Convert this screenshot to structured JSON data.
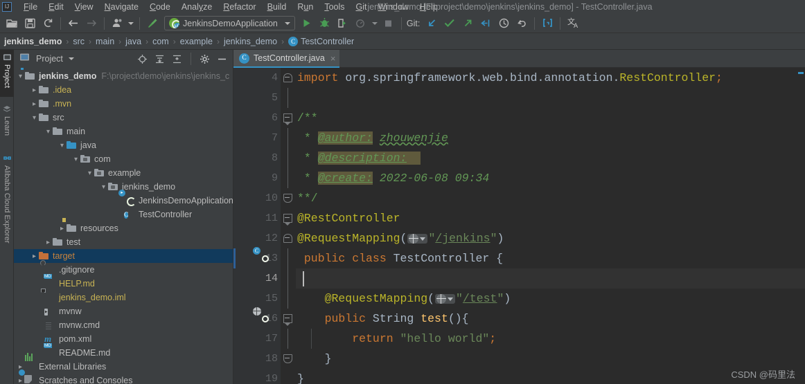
{
  "window": {
    "title": "jenkins_demo [F:\\project\\demo\\jenkins\\jenkins_demo] - TestController.java",
    "logo": "IJ"
  },
  "menubar": {
    "items": [
      {
        "label": "File",
        "mnemonic": "F"
      },
      {
        "label": "Edit",
        "mnemonic": "E"
      },
      {
        "label": "View",
        "mnemonic": "V"
      },
      {
        "label": "Navigate",
        "mnemonic": "N"
      },
      {
        "label": "Code",
        "mnemonic": "C"
      },
      {
        "label": "Analyze",
        "mnemonic": "y"
      },
      {
        "label": "Refactor",
        "mnemonic": "R"
      },
      {
        "label": "Build",
        "mnemonic": "B"
      },
      {
        "label": "Run",
        "mnemonic": "u"
      },
      {
        "label": "Tools",
        "mnemonic": "T"
      },
      {
        "label": "Git",
        "mnemonic": "G"
      },
      {
        "label": "Window",
        "mnemonic": "W"
      },
      {
        "label": "Help",
        "mnemonic": "H"
      }
    ]
  },
  "toolbar": {
    "open_project": "open-project-icon",
    "save_all": "save-all-icon",
    "sync": "refresh-sync-icon",
    "back": "navigate-back-icon",
    "forward": "navigate-forward-icon",
    "profile": "profile-icon",
    "build_hammer": "build-hammer-icon",
    "run_config_name": "JenkinsDemoApplication",
    "run": "run-icon",
    "debug": "debug-icon",
    "run_with_coverage": "run-with-coverage-icon",
    "profiler": "profiler-icon",
    "stop": "stop-icon",
    "git_label": "Git:",
    "git_update": "git-update-icon",
    "git_commit": "git-commit-icon",
    "git_push": "git-push-icon",
    "git_rollback_arrow": "git-revert-icon",
    "history": "history-icon",
    "undo": "undo-icon",
    "search_everywhere": "search-everywhere-icon",
    "translate": "translate-icon"
  },
  "breadcrumb": {
    "items": [
      "jenkins_demo",
      "src",
      "main",
      "java",
      "com",
      "example",
      "jenkins_demo",
      "TestController"
    ],
    "last_icon": "C",
    "separator": "›"
  },
  "project_panel": {
    "title": "Project",
    "dropdown_caret": "chevron-down-icon",
    "buttons": [
      {
        "name": "select-opened-file-icon"
      },
      {
        "name": "expand-all-icon"
      },
      {
        "name": "collapse-all-icon"
      },
      {
        "name": "settings-gear-icon"
      },
      {
        "name": "hide-panel-icon"
      }
    ],
    "tree": [
      {
        "depth": 0,
        "twist": "v",
        "icon": "module-folder",
        "label": "jenkins_demo",
        "bold": true,
        "path": "F:\\project\\demo\\jenkins\\jenkins_c",
        "selected": false
      },
      {
        "depth": 1,
        "twist": ">",
        "icon": "folder",
        "label": ".idea",
        "color": "yellow"
      },
      {
        "depth": 1,
        "twist": ">",
        "icon": "folder",
        "label": ".mvn",
        "color": "yellow"
      },
      {
        "depth": 1,
        "twist": "v",
        "icon": "folder",
        "label": "src"
      },
      {
        "depth": 2,
        "twist": "v",
        "icon": "folder",
        "label": "main"
      },
      {
        "depth": 3,
        "twist": "v",
        "icon": "folder-blue",
        "label": "java"
      },
      {
        "depth": 4,
        "twist": "v",
        "icon": "package",
        "label": "com"
      },
      {
        "depth": 5,
        "twist": "v",
        "icon": "package",
        "label": "example"
      },
      {
        "depth": 6,
        "twist": "v",
        "icon": "package",
        "label": "jenkins_demo"
      },
      {
        "depth": 7,
        "twist": "",
        "icon": "spring-class",
        "label": "JenkinsDemoApplication"
      },
      {
        "depth": 7,
        "twist": "",
        "icon": "class",
        "label": "TestController"
      },
      {
        "depth": 3,
        "twist": ">",
        "icon": "folder-resources",
        "label": "resources"
      },
      {
        "depth": 2,
        "twist": ">",
        "icon": "folder",
        "label": "test"
      },
      {
        "depth": 1,
        "twist": ">",
        "icon": "folder-orange",
        "label": "target",
        "color": "orange",
        "selected": true
      },
      {
        "depth": 2,
        "twist": "",
        "icon": "file-gitignore",
        "label": ".gitignore"
      },
      {
        "depth": 2,
        "twist": "",
        "icon": "file-md",
        "label": "HELP.md",
        "color": "yellow"
      },
      {
        "depth": 2,
        "twist": "",
        "icon": "file-iml",
        "label": "jenkins_demo.iml",
        "color": "yellow"
      },
      {
        "depth": 2,
        "twist": "",
        "icon": "file-script",
        "label": "mvnw"
      },
      {
        "depth": 2,
        "twist": "",
        "icon": "file-cmd",
        "label": "mvnw.cmd"
      },
      {
        "depth": 2,
        "twist": "",
        "icon": "file-maven",
        "label": "pom.xml"
      },
      {
        "depth": 2,
        "twist": "",
        "icon": "file-md",
        "label": "README.md"
      },
      {
        "depth": 0,
        "twist": ">",
        "icon": "external-libraries",
        "label": "External Libraries"
      },
      {
        "depth": 0,
        "twist": ">",
        "icon": "scratches",
        "label": "Scratches and Consoles"
      }
    ]
  },
  "tool_strip": {
    "tabs": [
      {
        "label": "Project",
        "icon": "project-icon",
        "active": true
      },
      {
        "label": "Learn",
        "icon": "learn-icon",
        "active": false
      },
      {
        "label": "Alibaba Cloud Explorer",
        "icon": "cloud-icon",
        "active": false
      }
    ]
  },
  "editor": {
    "tab": {
      "name": "TestController.java",
      "icon": "C",
      "close": "×"
    },
    "first_line_number": 4,
    "current_line": 14,
    "lines": [
      {
        "n": 4,
        "fold": "cap-top",
        "indent": 0,
        "tokens": [
          {
            "t": "import ",
            "c": "kw"
          },
          {
            "t": "org.springframework.web.bind.annotation.",
            "c": "cls"
          },
          {
            "t": "RestController",
            "c": "anno"
          },
          {
            "t": ";",
            "c": "kw"
          }
        ]
      },
      {
        "n": 5,
        "fold": "line",
        "indent": 0,
        "tokens": []
      },
      {
        "n": 6,
        "fold": "arrow",
        "indent": 0,
        "tokens": [
          {
            "t": "/**",
            "c": "cmt"
          }
        ]
      },
      {
        "n": 7,
        "fold": "line",
        "indent": 0,
        "tokens": [
          {
            "t": " * ",
            "c": "cmt"
          },
          {
            "t": "@author:",
            "c": "cmt-tag"
          },
          {
            "t": " ",
            "c": "cmt"
          },
          {
            "t": "zhouwenjie",
            "c": "cmt-val-squig"
          }
        ]
      },
      {
        "n": 8,
        "fold": "line",
        "indent": 0,
        "tokens": [
          {
            "t": " * ",
            "c": "cmt"
          },
          {
            "t": "@description:",
            "c": "cmt-tag"
          },
          {
            "t": " ",
            "c": "cmt"
          }
        ]
      },
      {
        "n": 9,
        "fold": "line",
        "indent": 0,
        "tokens": [
          {
            "t": " * ",
            "c": "cmt"
          },
          {
            "t": "@create:",
            "c": "cmt-tag"
          },
          {
            "t": " ",
            "c": "cmt"
          },
          {
            "t": "2022-06-08 09:34",
            "c": "cmt-val"
          }
        ]
      },
      {
        "n": 10,
        "fold": "cap-bot",
        "indent": 0,
        "tokens": [
          {
            "t": "**/",
            "c": "cmt"
          }
        ]
      },
      {
        "n": 11,
        "fold": "arrow",
        "indent": 0,
        "tokens": [
          {
            "t": "@RestController",
            "c": "anno"
          }
        ]
      },
      {
        "n": 12,
        "fold": "cap-top",
        "indent": 0,
        "tokens": [
          {
            "t": "@RequestMapping",
            "c": "anno"
          },
          {
            "t": "(",
            "c": "punct"
          },
          {
            "t": "web-inlay",
            "c": "inlay"
          },
          {
            "t": "\"",
            "c": "str"
          },
          {
            "t": "/jenkins",
            "c": "urlstr"
          },
          {
            "t": "\"",
            "c": "str"
          },
          {
            "t": ")",
            "c": "punct"
          }
        ]
      },
      {
        "n": 13,
        "fold": "none",
        "gutter_icon": "spring-bean-icon",
        "indent": 1,
        "tokens": [
          {
            "t": "public class ",
            "c": "kw"
          },
          {
            "t": "TestController ",
            "c": "cls"
          },
          {
            "t": "{",
            "c": "punct"
          }
        ]
      },
      {
        "n": 14,
        "fold": "none",
        "current": true,
        "indent": 1,
        "tokens": []
      },
      {
        "n": 15,
        "fold": "none",
        "indent": 2,
        "tokens": [
          {
            "t": "    @RequestMapping",
            "c": "anno"
          },
          {
            "t": "(",
            "c": "punct"
          },
          {
            "t": "web-inlay",
            "c": "inlay"
          },
          {
            "t": "\"",
            "c": "str"
          },
          {
            "t": "/test",
            "c": "urlstr"
          },
          {
            "t": "\"",
            "c": "str"
          },
          {
            "t": ")",
            "c": "punct"
          }
        ]
      },
      {
        "n": 16,
        "fold": "arrow",
        "gutter_icon": "web-endpoint-icon",
        "indent": 2,
        "tokens": [
          {
            "t": "    public ",
            "c": "kw"
          },
          {
            "t": "String ",
            "c": "cls"
          },
          {
            "t": "test",
            "c": "mth"
          },
          {
            "t": "(){",
            "c": "punct"
          }
        ]
      },
      {
        "n": 17,
        "fold": "line",
        "indent": 3,
        "tokens": [
          {
            "t": "        return ",
            "c": "kw"
          },
          {
            "t": "\"hello world\"",
            "c": "str"
          },
          {
            "t": ";",
            "c": "kw"
          }
        ]
      },
      {
        "n": 18,
        "fold": "cap-bot",
        "indent": 2,
        "tokens": [
          {
            "t": "    }",
            "c": "punct"
          }
        ]
      },
      {
        "n": 19,
        "fold": "none",
        "indent": 0,
        "tokens": [
          {
            "t": "}",
            "c": "punct"
          }
        ]
      }
    ]
  },
  "watermark": "CSDN @码里法",
  "colors": {
    "bg_chrome": "#3c3f41",
    "bg_editor": "#2b2b2b",
    "gutter": "#313335",
    "accent_blue": "#3592c4",
    "accent_green": "#6aab3e",
    "keyword_orange": "#cc7832",
    "string_green": "#6a8759",
    "annotation_yellow": "#bbb529",
    "comment_green": "#629755",
    "method_gold": "#ffc66d",
    "selection_blue": "#0d293e",
    "text_default": "#a9b7c6"
  }
}
